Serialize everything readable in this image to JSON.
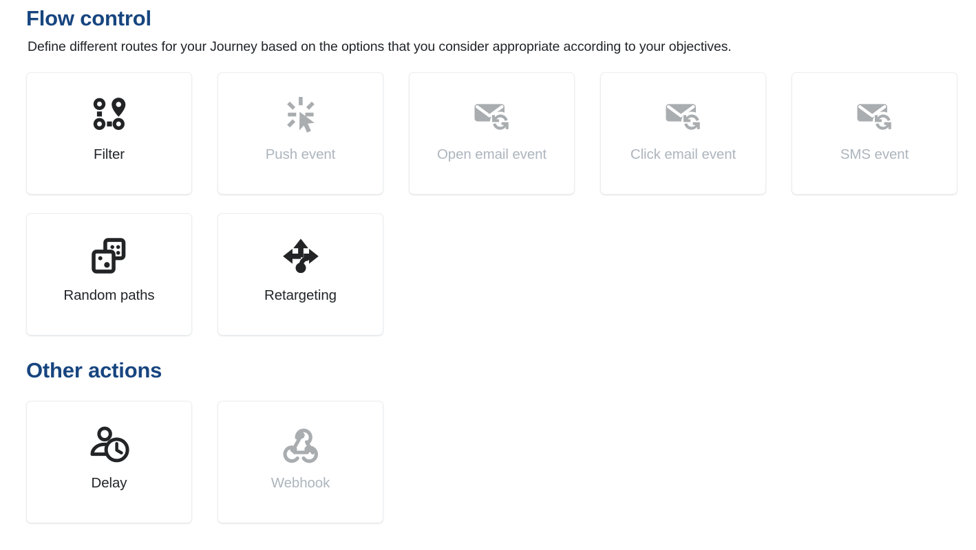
{
  "sections": [
    {
      "id": "flow-control",
      "title": "Flow control",
      "subtitle": "Define different routes for your Journey based on the options that you consider appropriate according to your objectives.",
      "cards": [
        {
          "label": "Filter",
          "icon": "route-pin-icon",
          "enabled": true
        },
        {
          "label": "Push event",
          "icon": "click-cursor-icon",
          "enabled": false
        },
        {
          "label": "Open email event",
          "icon": "email-sync-icon",
          "enabled": false
        },
        {
          "label": "Click email event",
          "icon": "email-sync-icon",
          "enabled": false
        },
        {
          "label": "SMS event",
          "icon": "email-sync-icon",
          "enabled": false
        },
        {
          "label": "Random paths",
          "icon": "dice-icon",
          "enabled": true
        },
        {
          "label": "Retargeting",
          "icon": "directions-arrows-icon",
          "enabled": true
        }
      ]
    },
    {
      "id": "other-actions",
      "title": "Other actions",
      "subtitle": "",
      "cards": [
        {
          "label": "Delay",
          "icon": "person-clock-icon",
          "enabled": true
        },
        {
          "label": "Webhook",
          "icon": "webhook-icon",
          "enabled": false
        }
      ]
    }
  ],
  "colors": {
    "heading": "#17457f",
    "text": "#212529",
    "disabled_text": "#adb5bd",
    "icon_enabled": "#222426",
    "icon_disabled": "#a9adb0",
    "card_border": "#ebedef",
    "background": "#ffffff"
  }
}
